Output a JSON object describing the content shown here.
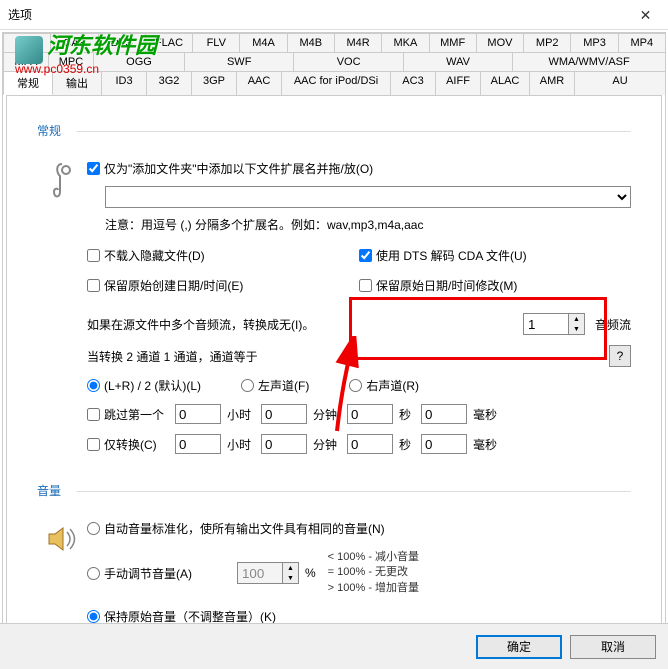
{
  "window": {
    "title": "选项",
    "close": "✕"
  },
  "watermark": {
    "line1": "河东软件园",
    "line2": "www.pc0359.cn"
  },
  "format_tabs_r1": [
    "AVI",
    "CAF",
    "DTS",
    "FLAC",
    "FLV",
    "M4A",
    "M4B",
    "M4R",
    "MKA",
    "MMF",
    "MOV",
    "MP2",
    "MP3",
    "MP4"
  ],
  "format_tabs_r2_left": [
    "MPA",
    "MPC"
  ],
  "format_tabs_r2_ogg": "OGG",
  "format_tabs_r2_swf": "SWF",
  "format_tabs_r2_voc": "VOC",
  "format_tabs_r2_wav": "WAV",
  "format_tabs_r2_wma": "WMA/WMV/ASF",
  "format_tabs_r3": [
    "常规",
    "输出",
    "ID3",
    "3G2",
    "3GP",
    "AAC",
    "AAC for iPod/DSi",
    "AC3",
    "AIFF",
    "ALAC",
    "AMR",
    "AU"
  ],
  "general": {
    "section": "常规",
    "only_add_folder": "仅为\"添加文件夹\"中添加以下文件扩展名并拖/放(O)",
    "note": "注意：用逗号 (,) 分隔多个扩展名。例如：wav,mp3,m4a,aac",
    "no_hidden": "不载入隐藏文件(D)",
    "keep_created": "保留原始创建日期/时间(E)",
    "use_dts": "使用 DTS 解码 CDA 文件(U)",
    "keep_modified": "保留原始日期/时间修改(M)",
    "multi_audio": "如果在源文件中多个音频流，转换成无(I)。",
    "audio_stream": "音频流",
    "stream_val": "1",
    "q": "?",
    "channel_label": "当转换 2 通道 1 通道，通道等于",
    "ch_lr": "(L+R) / 2 (默认)(L)",
    "ch_left": "左声道(F)",
    "ch_right": "右声道(R)",
    "skip_first": "跳过第一个",
    "only_convert": "仅转换(C)",
    "hour": "小时",
    "minute": "分钟",
    "second": "秒",
    "ms": "毫秒",
    "zero": "0"
  },
  "volume": {
    "section": "音量",
    "auto_norm": "自动音量标准化，使所有输出文件具有相同的音量(N)",
    "manual": "手动调节音量(A)",
    "pct": "100",
    "pct_sym": "%",
    "note1": "< 100% - 减小音量",
    "note2": "= 100% - 无更改",
    "note3": "> 100% - 增加音量",
    "keep": "保持原始音量（不调整音量）(K)"
  },
  "buttons": {
    "ok": "确定",
    "cancel": "取消"
  }
}
